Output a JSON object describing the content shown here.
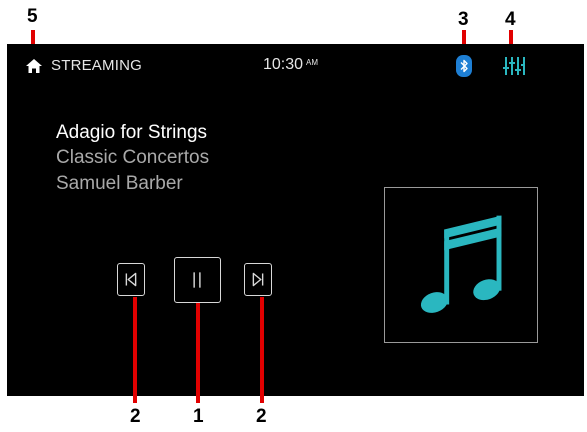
{
  "header": {
    "home_icon": "home-icon",
    "source_label": "STREAMING",
    "time": "10:30",
    "ampm": "AM",
    "bluetooth_icon": "bluetooth-icon",
    "eq_icon": "equalizer-icon"
  },
  "now_playing": {
    "title": "Adagio for Strings",
    "album": "Classic Concertos",
    "artist": "Samuel Barber"
  },
  "controls": {
    "prev_icon": "skip-previous-icon",
    "pause_icon": "pause-icon",
    "next_icon": "skip-next-icon"
  },
  "album_art_icon": "music-note-icon",
  "callouts": {
    "home": "5",
    "bluetooth": "3",
    "equalizer": "4",
    "prev": "2",
    "pause": "1",
    "next": "2"
  },
  "colors": {
    "accent": "#2ab7c0",
    "bluetooth_badge": "#1e7fd4",
    "callout_line": "#e10000",
    "screen_bg": "#000000"
  }
}
